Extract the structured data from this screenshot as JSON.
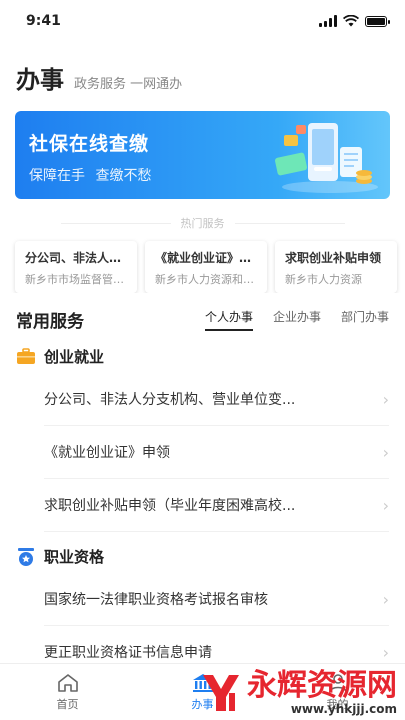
{
  "status": {
    "time": "9:41"
  },
  "header": {
    "title": "办事",
    "subtitle": "政务服务 一网通办"
  },
  "banner": {
    "title": "社保在线查缴",
    "subtitle": "保障在手 查缴不愁",
    "gradient_start": "#1e7ef0",
    "gradient_end": "#63c6fb"
  },
  "hot": {
    "title": "热门服务",
    "cards": [
      {
        "name": "分公司、非法人分...",
        "dept": "新乡市市场监督管理局"
      },
      {
        "name": "《就业创业证》申领",
        "dept": "新乡市人力资源和社会..."
      },
      {
        "name": "求职创业补贴申领",
        "dept": "新乡市人力资源"
      }
    ]
  },
  "services": {
    "title": "常用服务",
    "tabs": [
      {
        "label": "个人办事",
        "active": true
      },
      {
        "label": "企业办事",
        "active": false
      },
      {
        "label": "部门办事",
        "active": false
      }
    ],
    "categories": [
      {
        "label": "创业就业",
        "icon": "briefcase-icon",
        "color": "#f5a623",
        "items": [
          "分公司、非法人分支机构、营业单位变...",
          "《就业创业证》申领",
          "求职创业补贴申领（毕业年度困难高校..."
        ]
      },
      {
        "label": "职业资格",
        "icon": "badge-icon",
        "color": "#2f7be6",
        "items": [
          "国家统一法律职业资格考试报名审核",
          "更正职业资格证书信息申请"
        ]
      }
    ]
  },
  "tabbar": {
    "items": [
      {
        "label": "首页",
        "icon": "home-icon",
        "active": false
      },
      {
        "label": "办事",
        "icon": "government-building-icon",
        "active": true
      },
      {
        "label": "我的",
        "icon": "user-icon",
        "active": false
      }
    ]
  },
  "watermark": {
    "text": "永辉资源网",
    "url": "www.yhkjjj.com"
  },
  "colors": {
    "accent": "#1e7ef0",
    "text": "#222222",
    "muted": "#999999"
  }
}
